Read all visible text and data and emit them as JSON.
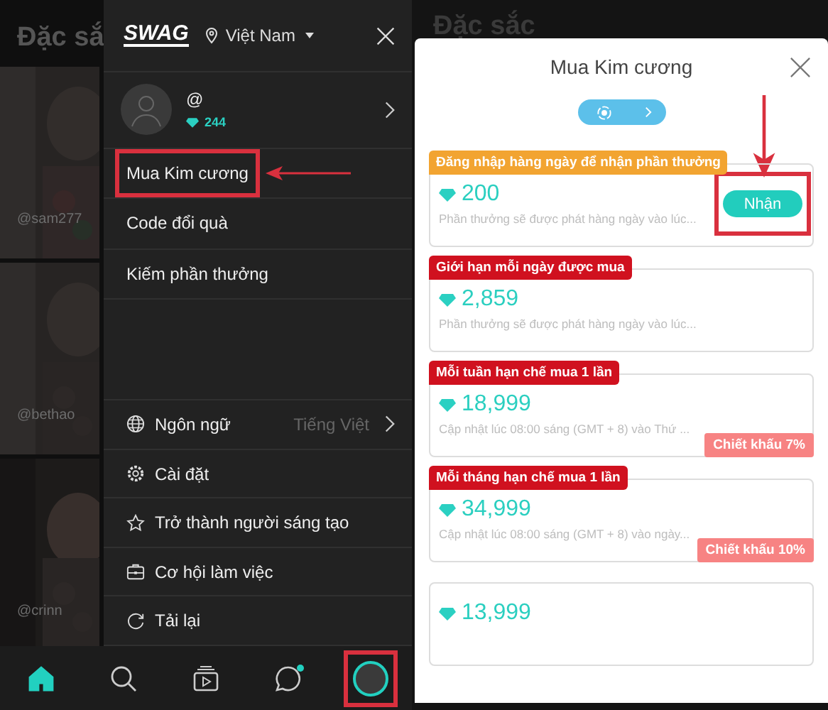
{
  "left_screen": {
    "background": {
      "title": "Đặc sắ",
      "tiles": [
        {
          "username": "@sam277",
          "kind": "picture"
        },
        {
          "username": "@bethao",
          "kind": "picture"
        },
        {
          "username": "@crinn",
          "kind": "picture"
        }
      ]
    },
    "drawer": {
      "logo": "SWAG",
      "location": "Việt Nam",
      "profile": {
        "handle": "@",
        "diamonds": "244"
      },
      "top_items": [
        {
          "label": "Mua Kim cương",
          "highlighted": true
        },
        {
          "label": "Code đổi quà",
          "highlighted": false
        },
        {
          "label": "Kiếm phần thưởng",
          "highlighted": false
        }
      ],
      "settings_items": [
        {
          "kind": "globe",
          "label": "Ngôn ngữ",
          "value": "Tiếng Việt"
        },
        {
          "kind": "gear",
          "label": "Cài đặt"
        },
        {
          "kind": "star",
          "label": "Trở thành người sáng tạo"
        },
        {
          "kind": "briefcase",
          "label": "Cơ hội làm việc"
        },
        {
          "kind": "reload",
          "label": "Tải lại"
        }
      ]
    },
    "bottom_nav": [
      {
        "kind": "home",
        "selected": true,
        "badge": false,
        "highlighted": false
      },
      {
        "kind": "search",
        "selected": false,
        "badge": false,
        "highlighted": false
      },
      {
        "kind": "video",
        "selected": false,
        "badge": false,
        "highlighted": false
      },
      {
        "kind": "chat",
        "selected": false,
        "badge": true,
        "highlighted": false
      },
      {
        "kind": "profile",
        "selected": false,
        "badge": false,
        "highlighted": true
      }
    ]
  },
  "right_screen": {
    "background_title": "Đặc sắc",
    "sheet": {
      "title": "Mua Kim cương",
      "packages": [
        {
          "tag": "Đăng nhập hàng ngày để nhận phần thưởng",
          "color": "#f2a431",
          "amount": "200",
          "note": "Phần thưởng sẽ được phát hàng ngày vào lúc...",
          "action": {
            "label": "Nhận",
            "highlighted": true
          }
        },
        {
          "tag": "Giới hạn mỗi ngày được mua",
          "color": "#d0111f",
          "amount": "2,859",
          "note": "Phần thưởng sẽ được phát hàng ngày vào lúc..."
        },
        {
          "tag": "Mỗi tuần hạn chế mua 1 lần",
          "color": "#d0111f",
          "amount": "18,999",
          "note": "Cập nhật lúc 08:00 sáng (GMT + 8) vào Thứ ...",
          "discount": "Chiết khấu 7%"
        },
        {
          "tag": "Mỗi tháng hạn chế mua 1 lần",
          "color": "#d0111f",
          "amount": "34,999",
          "note": "Cập nhật lúc 08:00 sáng (GMT + 8) vào ngày...",
          "discount": "Chiết khấu 10%"
        },
        {
          "amount": "13,999"
        }
      ]
    }
  }
}
